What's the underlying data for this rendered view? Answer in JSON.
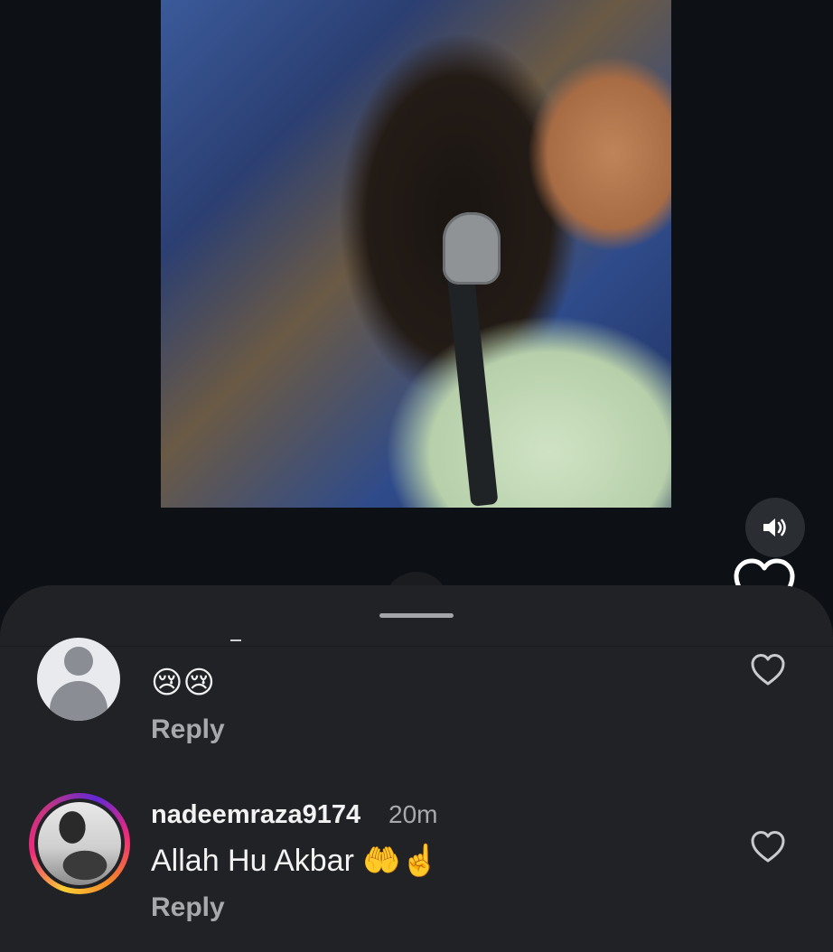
{
  "video": {
    "sound_icon": "speaker-icon",
    "like_icon": "heart-outline-icon"
  },
  "comments": [
    {
      "avatar": "default-avatar-icon",
      "text": "😢😢",
      "reply_label": "Reply",
      "like_icon": "heart-outline-icon"
    },
    {
      "username": "nadeemraza9174",
      "time": "20m",
      "text": "Allah Hu Akbar 🤲☝️",
      "reply_label": "Reply",
      "like_icon": "heart-outline-icon"
    }
  ],
  "colors": {
    "background": "#0f1115",
    "sheet": "#212226",
    "secondary_text": "#a7a9ad",
    "story_ring": [
      "#f9ce34",
      "#ee2a7b",
      "#6228d7"
    ]
  }
}
